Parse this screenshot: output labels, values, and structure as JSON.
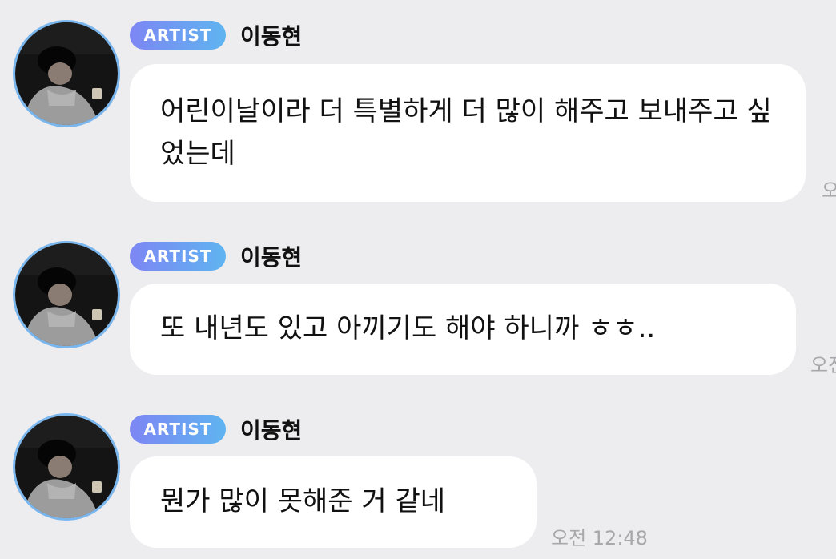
{
  "messages": [
    {
      "badge": "ARTIST",
      "sender": "이동현",
      "text": "어린이날이라 더 특별하게 더 많이 해주고 보내주고 싶었는데",
      "time": "오전"
    },
    {
      "badge": "ARTIST",
      "sender": "이동현",
      "text": "또 내년도 있고 아끼기도 해야 하니까 ㅎㅎ..",
      "time": "오전"
    },
    {
      "badge": "ARTIST",
      "sender": "이동현",
      "text": "뭔가 많이 못해준 거 같네",
      "time": "오전 12:48"
    }
  ],
  "colors": {
    "background": "#ededef",
    "bubble": "#ffffff",
    "badge_gradient_start": "#7d86f4",
    "badge_gradient_end": "#5fb4f0",
    "avatar_ring": "#7ab6ee",
    "timestamp": "#a8a8ac"
  },
  "icons": {
    "avatar": "artist-profile-photo"
  }
}
